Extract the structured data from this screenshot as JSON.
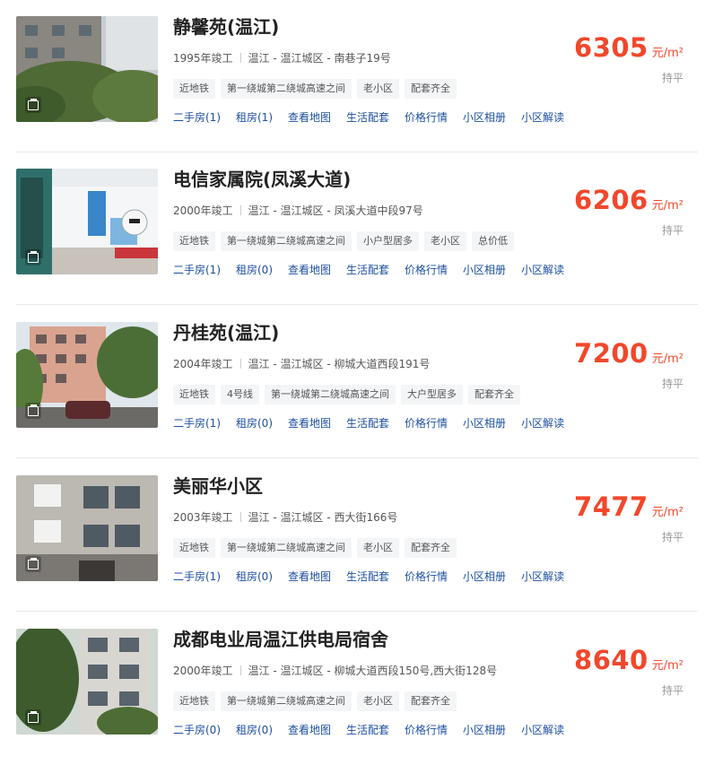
{
  "listings": [
    {
      "name": "静馨苑(温江)",
      "year": "1995年竣工",
      "address": "温江 - 温江城区 - 南巷子19号",
      "tags": [
        "近地铁",
        "第一绕城第二绕城高速之间",
        "老小区",
        "配套齐全"
      ],
      "links": [
        "二手房(1)",
        "租房(1)",
        "查看地图",
        "生活配套",
        "价格行情",
        "小区相册",
        "小区解读"
      ],
      "price": "6305",
      "unit": "元/m²",
      "trend": "持平"
    },
    {
      "name": "电信家属院(凤溪大道)",
      "year": "2000年竣工",
      "address": "温江 - 温江城区 - 凤溪大道中段97号",
      "tags": [
        "近地铁",
        "第一绕城第二绕城高速之间",
        "小户型居多",
        "老小区",
        "总价低"
      ],
      "links": [
        "二手房(1)",
        "租房(0)",
        "查看地图",
        "生活配套",
        "价格行情",
        "小区相册",
        "小区解读"
      ],
      "price": "6206",
      "unit": "元/m²",
      "trend": "持平"
    },
    {
      "name": "丹桂苑(温江)",
      "year": "2004年竣工",
      "address": "温江 - 温江城区 - 柳城大道西段191号",
      "tags": [
        "近地铁",
        "4号线",
        "第一绕城第二绕城高速之间",
        "大户型居多",
        "配套齐全"
      ],
      "links": [
        "二手房(1)",
        "租房(0)",
        "查看地图",
        "生活配套",
        "价格行情",
        "小区相册",
        "小区解读"
      ],
      "price": "7200",
      "unit": "元/m²",
      "trend": "持平"
    },
    {
      "name": "美丽华小区",
      "year": "2003年竣工",
      "address": "温江 - 温江城区 - 西大街166号",
      "tags": [
        "近地铁",
        "第一绕城第二绕城高速之间",
        "老小区",
        "配套齐全"
      ],
      "links": [
        "二手房(1)",
        "租房(0)",
        "查看地图",
        "生活配套",
        "价格行情",
        "小区相册",
        "小区解读"
      ],
      "price": "7477",
      "unit": "元/m²",
      "trend": "持平"
    },
    {
      "name": "成都电业局温江供电局宿舍",
      "year": "2000年竣工",
      "address": "温江 - 温江城区 - 柳城大道西段150号,西大街128号",
      "tags": [
        "近地铁",
        "第一绕城第二绕城高速之间",
        "老小区",
        "配套齐全"
      ],
      "links": [
        "二手房(0)",
        "租房(0)",
        "查看地图",
        "生活配套",
        "价格行情",
        "小区相册",
        "小区解读"
      ],
      "price": "8640",
      "unit": "元/m²",
      "trend": "持平"
    }
  ]
}
